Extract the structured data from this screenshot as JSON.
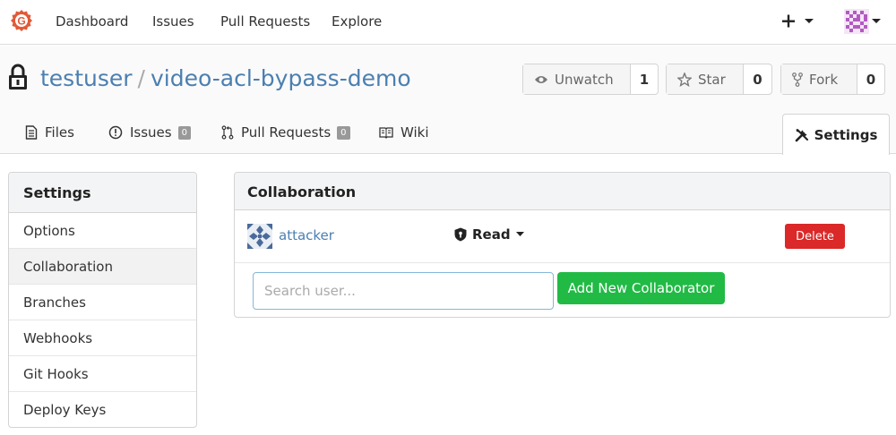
{
  "navbar": {
    "logo": "gitea-logo-icon",
    "items": [
      {
        "label": "Dashboard"
      },
      {
        "label": "Issues"
      },
      {
        "label": "Pull Requests"
      },
      {
        "label": "Explore"
      }
    ],
    "plus_icon": "plus-icon",
    "avatar_icon": "user-avatar"
  },
  "repo": {
    "owner": "testuser",
    "separator": "/",
    "name": "video-acl-bypass-demo",
    "watch": {
      "label": "Unwatch",
      "count": "1"
    },
    "star": {
      "label": "Star",
      "count": "0"
    },
    "fork": {
      "label": "Fork",
      "count": "0"
    }
  },
  "tabs": {
    "files": {
      "label": "Files"
    },
    "issues": {
      "label": "Issues",
      "count": "0"
    },
    "pulls": {
      "label": "Pull Requests",
      "count": "0"
    },
    "wiki": {
      "label": "Wiki"
    },
    "settings": {
      "label": "Settings"
    }
  },
  "sidebar": {
    "title": "Settings",
    "items": [
      {
        "label": "Options"
      },
      {
        "label": "Collaboration",
        "active": true
      },
      {
        "label": "Branches"
      },
      {
        "label": "Webhooks"
      },
      {
        "label": "Git Hooks"
      },
      {
        "label": "Deploy Keys"
      }
    ]
  },
  "collaboration": {
    "title": "Collaboration",
    "collaborators": [
      {
        "name": "attacker",
        "permission": "Read",
        "delete_label": "Delete"
      }
    ],
    "search": {
      "placeholder": "Search user..."
    },
    "add_label": "Add New Collaborator"
  },
  "colors": {
    "link": "#4b7fb0",
    "danger": "#db2828",
    "success": "#21ba45",
    "logo": "#e15a37"
  }
}
